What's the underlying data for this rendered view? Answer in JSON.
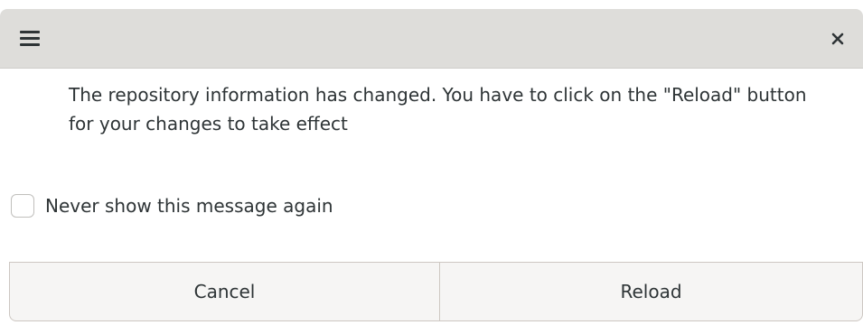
{
  "titlebar": {
    "menu_icon": "hamburger-menu-icon",
    "close_icon": "close-icon"
  },
  "message": {
    "text": "The repository information has changed. You have to click on the \"Reload\" button for your changes to take effect"
  },
  "checkbox": {
    "label": "Never show this message again",
    "checked": false
  },
  "buttons": {
    "cancel_label": "Cancel",
    "reload_label": "Reload"
  },
  "colors": {
    "titlebar_bg": "#deddda",
    "text": "#2e3436",
    "button_bg": "#f6f5f4",
    "border": "#cdc7c2"
  }
}
